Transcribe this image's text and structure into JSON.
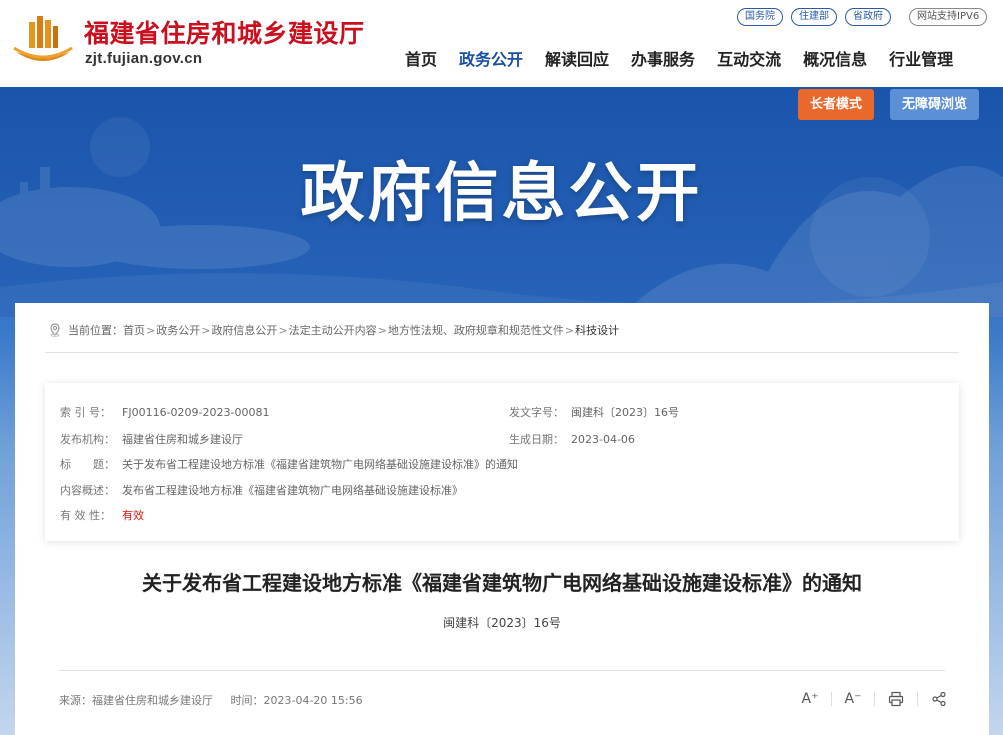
{
  "header": {
    "site_name": "福建省住房和城乡建设厅",
    "site_domain": "zjt.fujian.gov.cn",
    "top_links": [
      "国务院",
      "住建部",
      "省政府"
    ],
    "ipv6_label": "网站支持IPV6",
    "nav": [
      "首页",
      "政务公开",
      "解读回应",
      "办事服务",
      "互动交流",
      "概况信息",
      "行业管理"
    ],
    "active_nav": "政务公开"
  },
  "banner": {
    "title": "政府信息公开",
    "elder_mode": "长者模式",
    "accessible": "无障碍浏览"
  },
  "breadcrumb": {
    "prefix": "当前位置：",
    "items": [
      "首页",
      "政务公开",
      "政府信息公开",
      "法定主动公开内容",
      "地方性法规、政府规章和规范性文件",
      "科技设计"
    ],
    "sep": ">"
  },
  "meta": {
    "index_no_label": "索 引 号：",
    "index_no": "FJ00116-0209-2023-00081",
    "doc_no_label": "发文字号：",
    "doc_no": "闽建科〔2023〕16号",
    "issuer_label": "发布机构：",
    "issuer": "福建省住房和城乡建设厅",
    "date_label": "生成日期：",
    "date": "2023-04-06",
    "title_label": "标　　题：",
    "title": "关于发布省工程建设地方标准《福建省建筑物广电网络基础设施建设标准》的通知",
    "summary_label": "内容概述：",
    "summary": "发布省工程建设地方标准《福建省建筑物广电网络基础设施建设标准》",
    "validity_label": "有 效 性：",
    "validity": "有效"
  },
  "document": {
    "title": "关于发布省工程建设地方标准《福建省建筑物广电网络基础设施建设标准》的通知",
    "number": "闽建科〔2023〕16号",
    "source": "来源：福建省住房和城乡建设厅",
    "time": "时间：2023-04-20 15:56"
  },
  "tools": {
    "font_up": "A⁺",
    "font_down": "A⁻"
  },
  "colors": {
    "brand_red": "#c8101e",
    "nav_active": "#1a4fa0",
    "elder_btn": "#e9682b",
    "access_btn": "#5b8fd6"
  }
}
